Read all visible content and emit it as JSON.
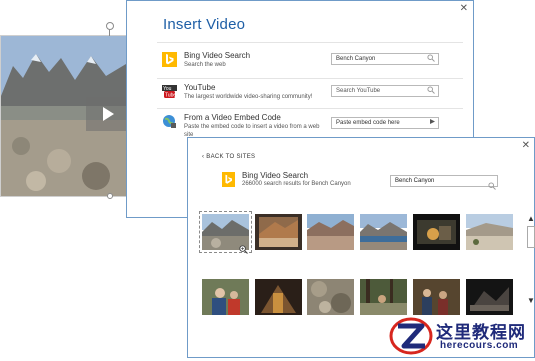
{
  "insert_dialog": {
    "title": "Insert Video",
    "close": "✕",
    "sources": [
      {
        "icon": "bing-icon",
        "name": "Bing Video Search",
        "description": "Search the web",
        "input_value": "Bench Canyon",
        "input_placeholder": "",
        "button": "search-icon"
      },
      {
        "icon": "youtube-icon",
        "name": "YouTube",
        "description": "The largest worldwide video-sharing community!",
        "input_value": "",
        "input_placeholder": "Search YouTube",
        "button": "search-icon"
      },
      {
        "icon": "embed-icon",
        "name": "From a Video Embed Code",
        "description": "Paste the embed code to insert a video from a web site",
        "input_value": "",
        "input_placeholder": "Paste embed code here",
        "button": "insert-arrow-icon"
      }
    ]
  },
  "results_dialog": {
    "back_label": "BACK TO SITES",
    "close": "✕",
    "source_name": "Bing Video Search",
    "results_count": "266000 search results for Bench Canyon",
    "search_value": "Bench Canyon",
    "zoom_icon": "magnifier-plus-icon",
    "scroll_up": "▲",
    "scroll_down": "▼",
    "thumbnails_row1": [
      "mountain-lake",
      "rocky-cliff",
      "canyon-ridge",
      "lake-view",
      "campfire-video",
      "high-plateau"
    ],
    "thumbnails_row2": [
      "hikers-camp",
      "cave-interior",
      "rocky-trail",
      "forest-path",
      "camp-people",
      "dark-ridge"
    ]
  },
  "colors": {
    "dialog_border": "#6f9bc8",
    "title_blue": "#1f5fa6",
    "bing_orange": "#ffb900",
    "youtube_red": "#cc181e",
    "watermark_red": "#d7261e",
    "watermark_navy": "#1f2a7a"
  },
  "watermark": {
    "chinese": "这里教程网",
    "domain": "herecours.com"
  }
}
